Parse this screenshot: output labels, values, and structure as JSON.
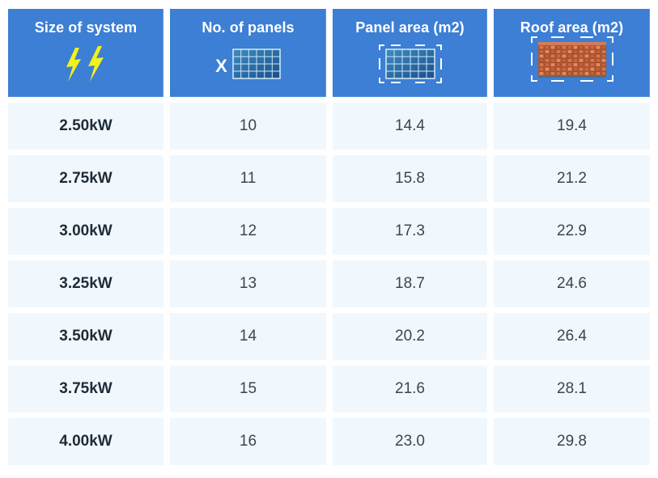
{
  "table": {
    "headers": [
      {
        "label": "Size of system",
        "icon": "lightning-icon"
      },
      {
        "label": "No. of panels",
        "icon": "solar-panel-icon",
        "prefix": "X"
      },
      {
        "label": "Panel area (m2)",
        "icon": "solar-panel-area-icon"
      },
      {
        "label": "Roof area (m2)",
        "icon": "roof-tiles-area-icon"
      }
    ],
    "rows": [
      {
        "size": "2.50kW",
        "panels": "10",
        "panel_area": "14.4",
        "roof_area": "19.4"
      },
      {
        "size": "2.75kW",
        "panels": "11",
        "panel_area": "15.8",
        "roof_area": "21.2"
      },
      {
        "size": "3.00kW",
        "panels": "12",
        "panel_area": "17.3",
        "roof_area": "22.9"
      },
      {
        "size": "3.25kW",
        "panels": "13",
        "panel_area": "18.7",
        "roof_area": "24.6"
      },
      {
        "size": "3.50kW",
        "panels": "14",
        "panel_area": "20.2",
        "roof_area": "26.4"
      },
      {
        "size": "3.75kW",
        "panels": "15",
        "panel_area": "21.6",
        "roof_area": "28.1"
      },
      {
        "size": "4.00kW",
        "panels": "16",
        "panel_area": "23.0",
        "roof_area": "29.8"
      }
    ]
  },
  "colors": {
    "header_bg": "#3c7fd4",
    "cell_bg": "#f0f8fe",
    "lightning": "#f2f21a",
    "roof_tile": "#c1623d"
  }
}
